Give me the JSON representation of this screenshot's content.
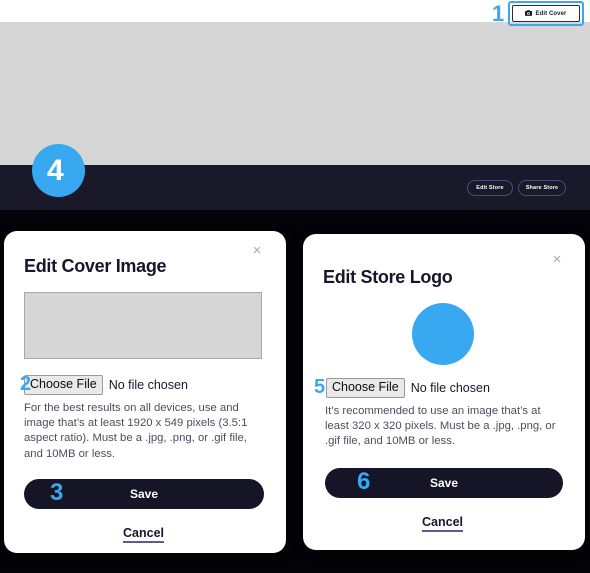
{
  "page": {
    "background_cover_color": "#d6d6d6",
    "nav_bar_color": "#191929",
    "page_body_color": "#040408",
    "accent_color": "#38a9f0"
  },
  "header": {
    "edit_cover_button": "Edit Cover",
    "edit_cover_icon": "camera-icon"
  },
  "nav": {
    "edit_store_button": "Edit Store",
    "share_store_button": "Share Store",
    "avatar_label": "store-avatar"
  },
  "cover_modal": {
    "title": "Edit Cover Image",
    "close_icon": "×",
    "file_button": "Choose File",
    "file_status": "No file chosen",
    "description": "For the best results on all devices, use and image that’s at least 1920 x 549 pixels (3.5:1 aspect ratio). Must be a .jpg, .png, or .gif file, and 10MB or less.",
    "save_label": "Save",
    "cancel_label": "Cancel"
  },
  "logo_modal": {
    "title": "Edit Store Logo",
    "close_icon": "×",
    "file_button": "Choose File",
    "file_status": "No file chosen",
    "description": "It’s recommended to use an image that’s at least 320 x 320 pixels. Must be a .jpg, .png, or .gif file, and 10MB or less.",
    "save_label": "Save",
    "cancel_label": "Cancel"
  },
  "annotations": {
    "one": "1",
    "two": "2",
    "three": "3",
    "four": "4",
    "five": "5",
    "six": "6"
  }
}
